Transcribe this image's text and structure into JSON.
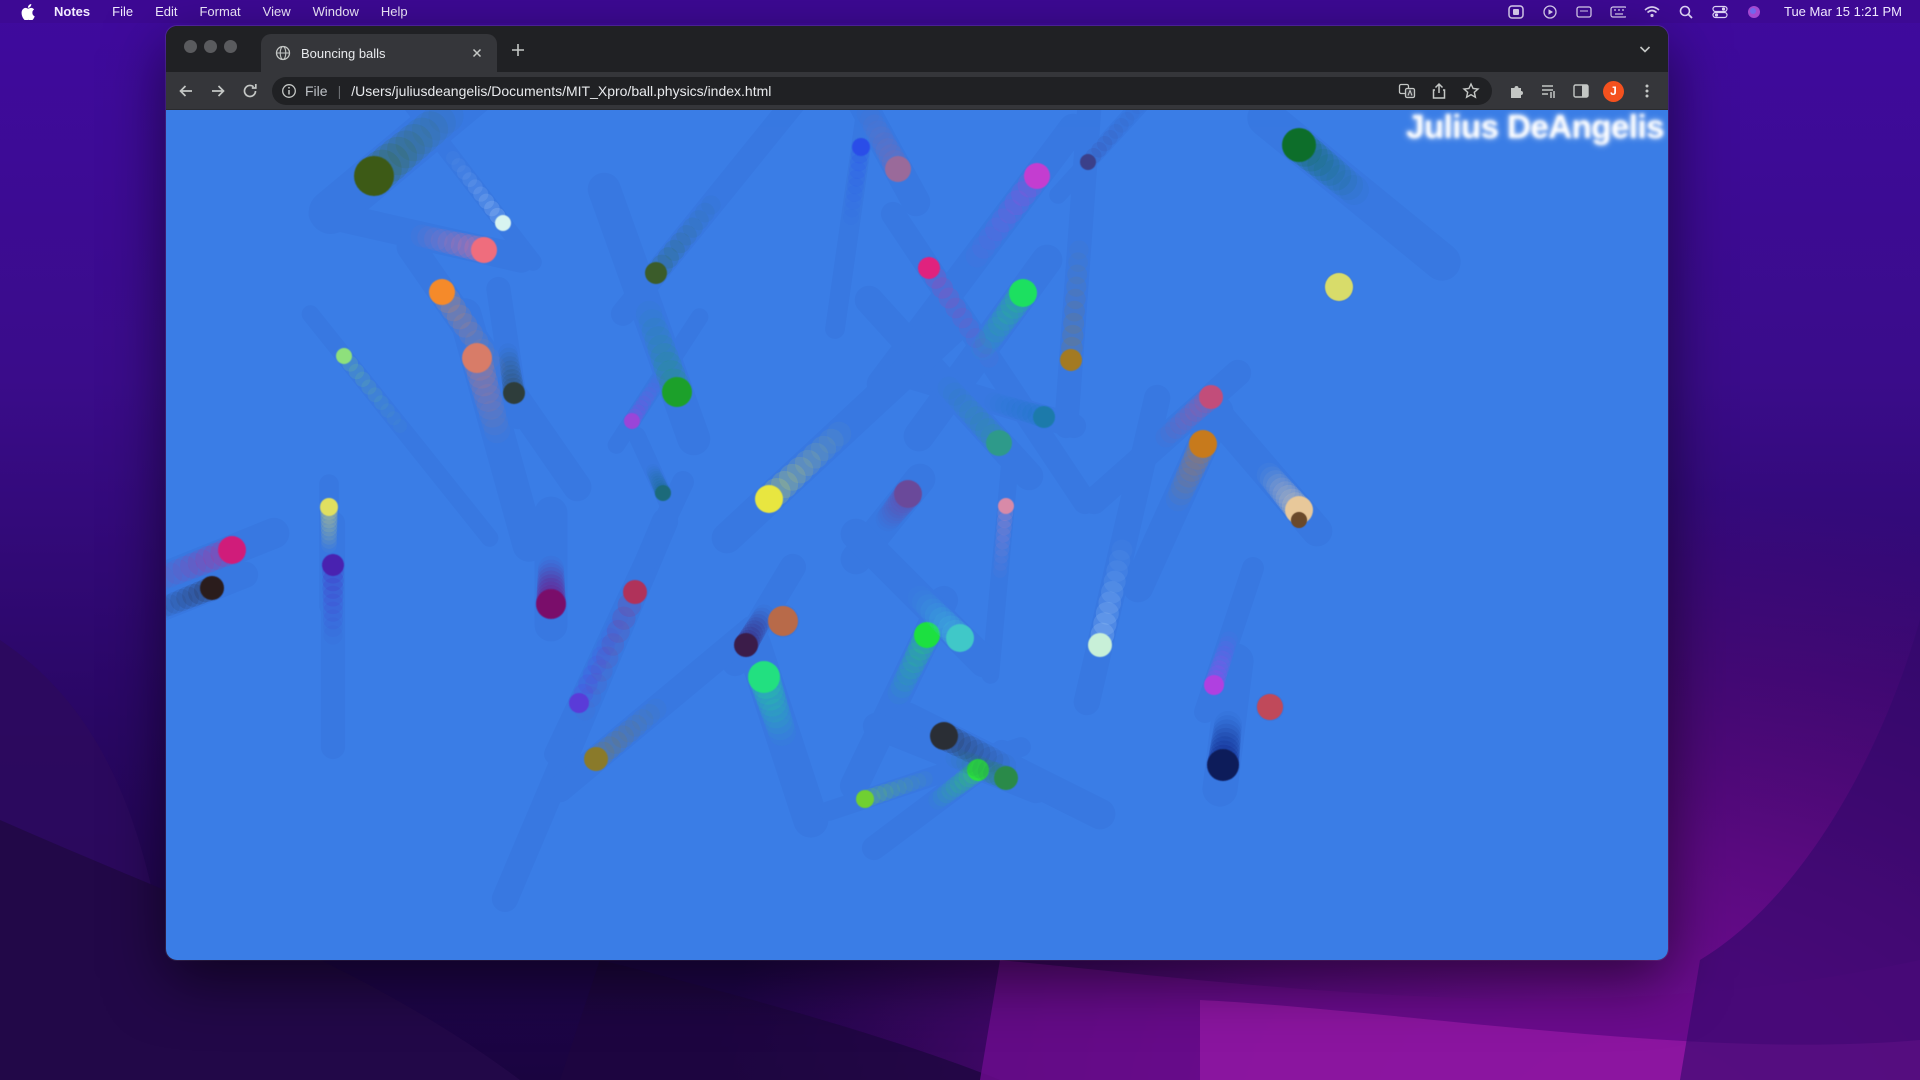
{
  "menubar": {
    "items": [
      "Notes",
      "File",
      "Edit",
      "Format",
      "View",
      "Window",
      "Help"
    ],
    "clock": "Tue Mar 15  1:21 PM",
    "status_icons": [
      "screen-record-icon",
      "play-icon",
      "display-icon",
      "keyboard-layout-icon",
      "wifi-icon",
      "spotlight-search-icon",
      "control-center-icon",
      "siri-icon"
    ]
  },
  "browser": {
    "tab_title": "Bouncing balls",
    "scheme_label": "File",
    "url": "/Users/juliusdeangelis/Documents/MIT_Xpro/ball.physics/index.html",
    "profile_initial": "J"
  },
  "page": {
    "background": "#3a7de6",
    "signature": "Julius DeAngelis"
  },
  "balls": [
    {
      "color": "#3c5a12",
      "trail": "#3c6a20"
    },
    {
      "color": "#d8f4f0",
      "trail": "#cfe6ff"
    },
    {
      "color": "#ef6d7d",
      "trail": "#ff6f8c"
    },
    {
      "color": "#f58a2a",
      "trail": "#f48a40"
    },
    {
      "color": "#d87c68",
      "trail": "#d77a6c"
    },
    {
      "color": "#2f3e3a",
      "trail": "#2f4b52"
    },
    {
      "color": "#8ee07c",
      "trail": "#7fd57a"
    },
    {
      "color": "#3b5b2a",
      "trail": "#2f6a4a"
    },
    {
      "color": "#1fa02a",
      "trail": "#1fa060"
    },
    {
      "color": "#9a44d8",
      "trail": "#9a44e0"
    },
    {
      "color": "#1a6a7a",
      "trail": "#1a6a8a"
    },
    {
      "color": "#2a4ee8",
      "trail": "#2a4ef0"
    },
    {
      "color": "#9a6a9a",
      "trail": "#8a6aa8"
    },
    {
      "color": "#c43ed0",
      "trail": "#b540d8"
    },
    {
      "color": "#3a3f8a",
      "trail": "#3a4a9a"
    },
    {
      "color": "#0b6e2a",
      "trail": "#0b6e40"
    },
    {
      "color": "#e0207e",
      "trail": "#d0309a"
    },
    {
      "color": "#1fe060",
      "trail": "#1fd070"
    },
    {
      "color": "#a37a22",
      "trail": "#9a7a30"
    },
    {
      "color": "#d8dc6a",
      "trail": "#d8dc6a"
    },
    {
      "color": "#c24e7a",
      "trail": "#c24e8a"
    },
    {
      "color": "#c77a1e",
      "trail": "#c77a30"
    },
    {
      "color": "#1a7aaa",
      "trail": "#1a7ac0"
    },
    {
      "color": "#2f9a8a",
      "trail": "#2f9a8a"
    },
    {
      "color": "#e8e640",
      "trail": "#e8e640"
    },
    {
      "color": "#6a4a9a",
      "trail": "#6a4aaa"
    },
    {
      "color": "#d88aa8",
      "trail": "#d88ab8"
    },
    {
      "color": "#e8c89a",
      "trail": "#e8d0b0"
    },
    {
      "color": "#6a4a2a",
      "trail": "#6a4a3a"
    },
    {
      "color": "#e0e060",
      "trail": "#e0e070"
    },
    {
      "color": "#4a22b0",
      "trail": "#4a22c0"
    },
    {
      "color": "#d01e7a",
      "trail": "#d0208a"
    },
    {
      "color": "#2a1a1a",
      "trail": "#2a2a3a"
    },
    {
      "color": "#7a0a6a",
      "trail": "#7a0a7a"
    },
    {
      "color": "#b0305a",
      "trail": "#9a307a"
    },
    {
      "color": "#5a3ad8",
      "trail": "#5a3ae0"
    },
    {
      "color": "#3a1a4a",
      "trail": "#3a1a6a"
    },
    {
      "color": "#b86a4a",
      "trail": "#b86a5a"
    },
    {
      "color": "#20e080",
      "trail": "#20e090"
    },
    {
      "color": "#1ee040",
      "trail": "#1ee060"
    },
    {
      "color": "#3fc8c8",
      "trail": "#3fc8d8"
    },
    {
      "color": "#c8f0d8",
      "trail": "#c8e8ff"
    },
    {
      "color": "#b040e0",
      "trail": "#b040f0"
    },
    {
      "color": "#c04a5a",
      "trail": "#c04a6a"
    },
    {
      "color": "#8a7a2a",
      "trail": "#8a7a3a"
    },
    {
      "color": "#2a2e34",
      "trail": "#2a3040"
    },
    {
      "color": "#2ce040",
      "trail": "#2ce050"
    },
    {
      "color": "#2a8a4a",
      "trail": "#2a8a5a"
    },
    {
      "color": "#0a1a5a",
      "trail": "#0a1a7a"
    },
    {
      "color": "#70d030",
      "trail": "#70d040"
    }
  ]
}
